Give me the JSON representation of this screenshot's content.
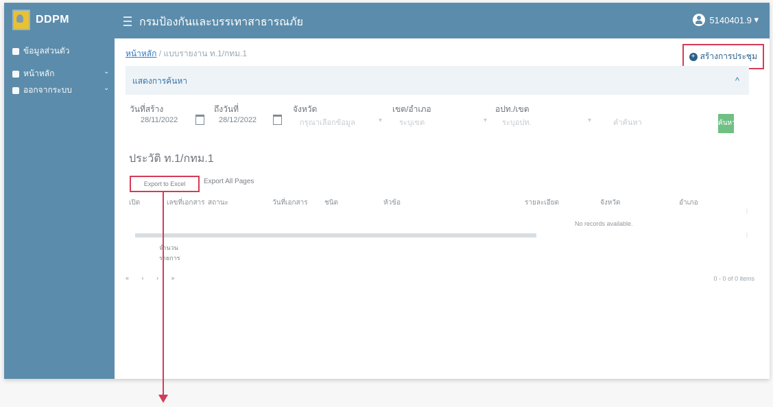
{
  "app": {
    "logo_text": "DDPM",
    "title": "กรมป้องกันและบรรเทาสาธารณภัย",
    "user": "5140401.9"
  },
  "sidebar": {
    "items": [
      {
        "label": "ข้อมูลส่วนตัว"
      },
      {
        "label": "หน้าหลัก",
        "caret": "⌄"
      },
      {
        "label": "ออกจากระบบ",
        "caret": "⌄"
      }
    ]
  },
  "breadcrumb": {
    "home": "หน้าหลัก",
    "separator": "/",
    "current": "แบบรายงาน ท.1/กทม.1"
  },
  "actions": {
    "create_meeting": "สร้างการประชุม",
    "plus_icon": "+"
  },
  "search_panel": {
    "title": "แสดงการค้นหา",
    "toggle_icon": "^",
    "filters": {
      "date_from_label": "วันที่สร้าง",
      "date_from_value": "28/11/2022",
      "date_to_label": "ถึงวันที่",
      "date_to_value": "28/12/2022",
      "province_label": "จังหวัด",
      "province_placeholder": "กรุณาเลือกข้อมูล",
      "district_label": "เขต/อำเภอ",
      "district_placeholder": "ระบุเขต",
      "org_label": "อปท./เขต",
      "org_placeholder": "ระบุอปท.",
      "keyword_placeholder": "คำค้นหา",
      "search_button": "ค้นหา"
    }
  },
  "section": {
    "title": "ประวัติ ท.1/กทม.1"
  },
  "exports": {
    "excel": "Export to Excel",
    "all_pages": "Export All Pages"
  },
  "table": {
    "headers": [
      "เปิด",
      "เลขที่เอกสาร",
      "สถานะ",
      "วันที่เอกสาร",
      "ชนิด",
      "หัวข้อ",
      "รายละเอียด",
      "จังหวัด",
      "อำเภอ"
    ],
    "empty_text": "No records available."
  },
  "footer": {
    "count_label_line1": "จำนวน",
    "count_label_line2": "รายการ",
    "pager": "« ‹ › »",
    "items_text": "0 - 0 of 0 items"
  },
  "colors": {
    "accent_blue": "#5c8cab",
    "annotation_red": "#d43b57",
    "search_green": "#6fc083"
  }
}
